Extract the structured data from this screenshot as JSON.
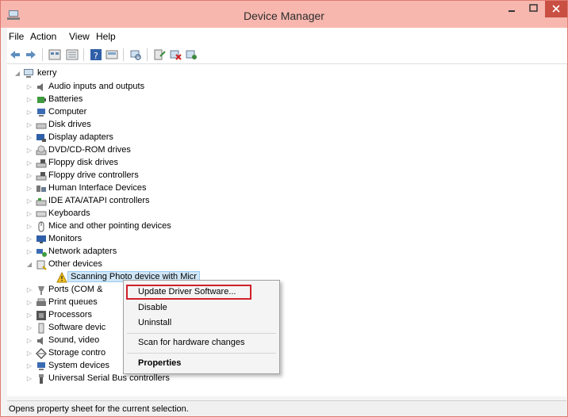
{
  "window": {
    "title": "Device Manager"
  },
  "menubar": {
    "items": [
      "File",
      "Action",
      "View",
      "Help"
    ]
  },
  "tree": {
    "root": "kerry",
    "items": [
      "Audio inputs and outputs",
      "Batteries",
      "Computer",
      "Disk drives",
      "Display adapters",
      "DVD/CD-ROM drives",
      "Floppy disk drives",
      "Floppy drive controllers",
      "Human Interface Devices",
      "IDE ATA/ATAPI controllers",
      "Keyboards",
      "Mice and other pointing devices",
      "Monitors",
      "Network adapters",
      "Other devices",
      "Scanning Photo device with Micr",
      "Ports (COM &",
      "Print queues",
      "Processors",
      "Software devic",
      "Sound, video",
      "Storage contro",
      "System devices",
      "Universal Serial Bus controllers"
    ]
  },
  "context_menu": {
    "update": "Update Driver Software...",
    "disable": "Disable",
    "uninstall": "Uninstall",
    "scan": "Scan for hardware changes",
    "properties": "Properties"
  },
  "status": {
    "text": "Opens property sheet for the current selection."
  },
  "colors": {
    "titlebar": "#f7b7ae",
    "close": "#c94f43",
    "selection": "#cfe6f7",
    "highlight_box": "#d0202a"
  }
}
